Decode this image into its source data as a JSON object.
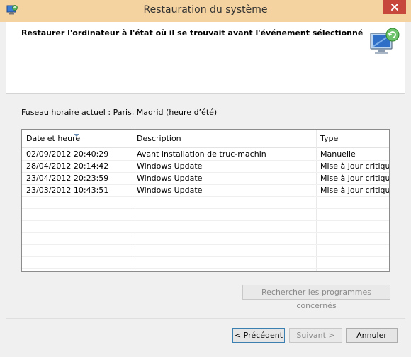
{
  "window": {
    "title": "Restauration du système",
    "header_text": "Restaurer l'ordinateur à l'état où il se trouvait avant l'événement sélectionné"
  },
  "timezone_label": "Fuseau horaire actuel : Paris, Madrid (heure d’été)",
  "list": {
    "columns": [
      "Date et heure",
      "Description",
      "Type"
    ],
    "rows": [
      {
        "date": "02/09/2012 20:40:29",
        "description": "Avant installation de truc-machin",
        "type": "Manuelle"
      },
      {
        "date": "28/04/2012 20:14:42",
        "description": "Windows Update",
        "type": "Mise à jour critique"
      },
      {
        "date": "23/04/2012 20:23:59",
        "description": "Windows Update",
        "type": "Mise à jour critique"
      },
      {
        "date": "23/03/2012 10:43:51",
        "description": "Windows Update",
        "type": "Mise à jour critique"
      }
    ]
  },
  "buttons": {
    "scan": "Rechercher les programmes concernés",
    "previous": "< Précédent",
    "next": "Suivant >",
    "cancel": "Annuler"
  },
  "colors": {
    "titlebar": "#f4d3a0",
    "close": "#c7473c"
  }
}
